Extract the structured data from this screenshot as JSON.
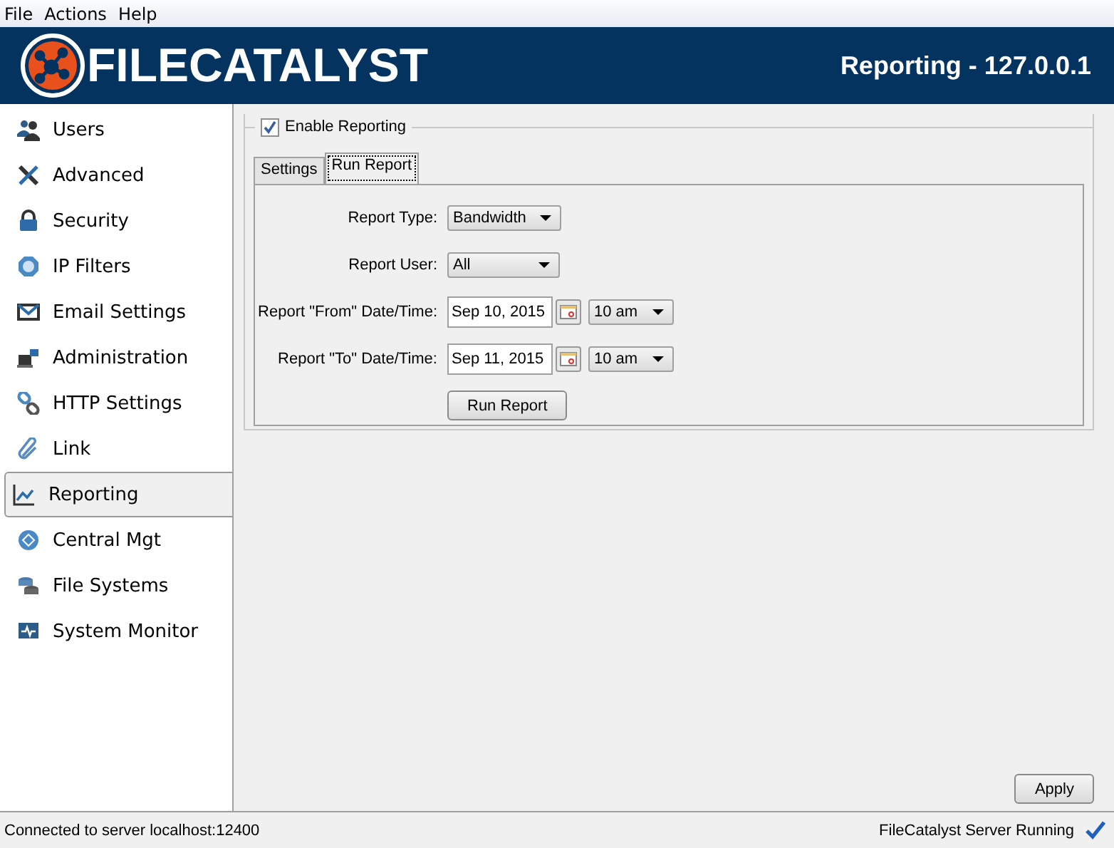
{
  "menu": [
    "File",
    "Actions",
    "Help"
  ],
  "header": {
    "logo": "FILECATALYST",
    "title": "Reporting - 127.0.0.1"
  },
  "sidebar": {
    "items": [
      {
        "label": "Users",
        "selected": false
      },
      {
        "label": "Advanced",
        "selected": false
      },
      {
        "label": "Security",
        "selected": false
      },
      {
        "label": "IP Filters",
        "selected": false
      },
      {
        "label": "Email Settings",
        "selected": false
      },
      {
        "label": "Administration",
        "selected": false
      },
      {
        "label": "HTTP Settings",
        "selected": false
      },
      {
        "label": "Link",
        "selected": false
      },
      {
        "label": "Reporting",
        "selected": true
      },
      {
        "label": "Central Mgt",
        "selected": false
      },
      {
        "label": "File Systems",
        "selected": false
      },
      {
        "label": "System Monitor",
        "selected": false
      }
    ]
  },
  "enable_reporting": {
    "label": "Enable Reporting",
    "checked": true
  },
  "tabs": [
    {
      "label": "Settings",
      "selected": false
    },
    {
      "label": "Run Report",
      "selected": true
    }
  ],
  "form": [
    {
      "kind": "dropdown",
      "label": "Report Type:",
      "value": "Bandwidth"
    },
    {
      "kind": "dropdown",
      "label": "Report User:",
      "value": "All"
    },
    {
      "kind": "datetime",
      "label": "Report \"From\" Date/Time:",
      "date": "Sep 10, 2015",
      "time": "10 am"
    },
    {
      "kind": "datetime",
      "label": "Report \"To\" Date/Time:",
      "date": "Sep 11, 2015",
      "time": "10 am"
    }
  ],
  "run_button": "Run Report",
  "apply_button": "Apply",
  "status_bar": {
    "connection": "Connected to server localhost:12400",
    "server": "FileCatalyst Server Running"
  }
}
